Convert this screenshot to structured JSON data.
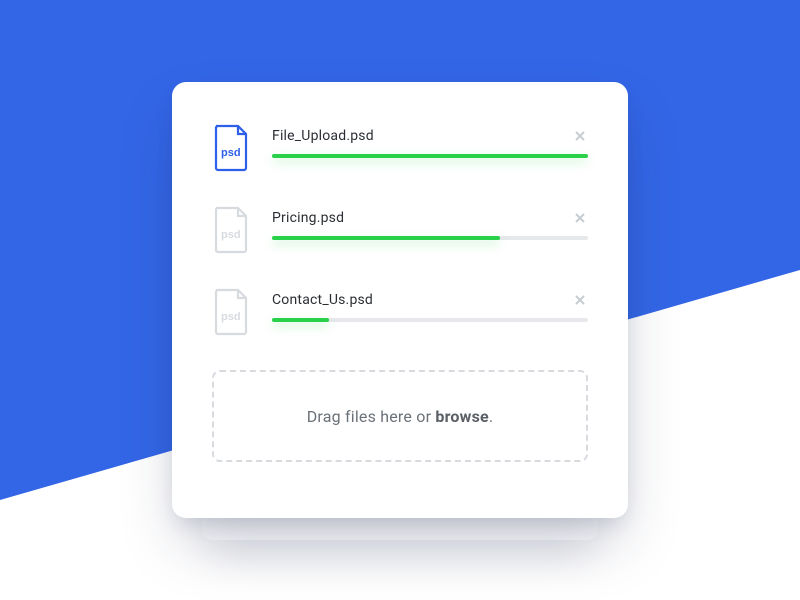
{
  "files": [
    {
      "name": "File_Upload.psd",
      "ext": "psd",
      "progress": 100,
      "state": "active"
    },
    {
      "name": "Pricing.psd",
      "ext": "psd",
      "progress": 72,
      "state": "muted"
    },
    {
      "name": "Contact_Us.psd",
      "ext": "psd",
      "progress": 18,
      "state": "muted"
    }
  ],
  "dropzone": {
    "prefix": "Drag files here or ",
    "action": "browse",
    "suffix": "."
  },
  "colors": {
    "accent": "#3366e6",
    "progress": "#29d14a"
  }
}
